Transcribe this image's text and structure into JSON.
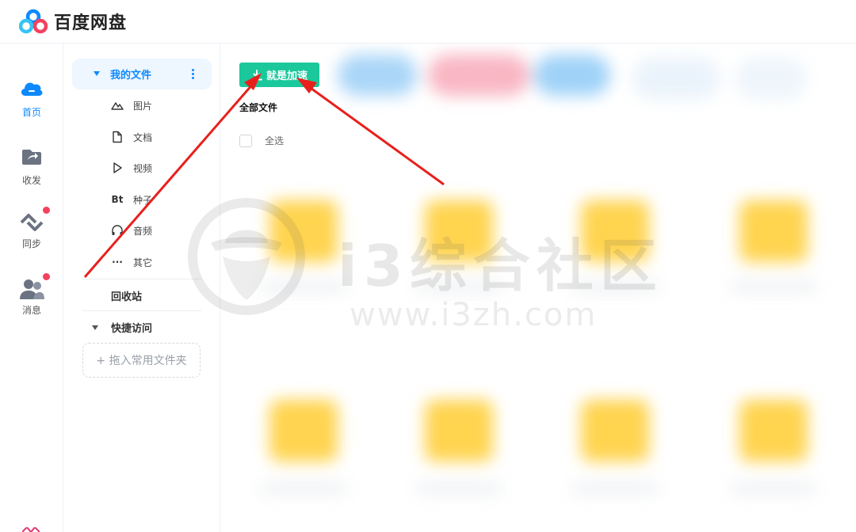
{
  "app": {
    "title": "百度网盘",
    "brand_colors": {
      "blue": "#0d89ff",
      "green": "#1ac89b",
      "red_dot": "#f3415e",
      "folder": "#ffd44f"
    }
  },
  "rail": {
    "items": [
      {
        "id": "home",
        "label": "首页",
        "icon": "cloud-icon",
        "active": true,
        "badge": false
      },
      {
        "id": "share",
        "label": "收发",
        "icon": "share-folder-icon",
        "active": false,
        "badge": false
      },
      {
        "id": "sync",
        "label": "同步",
        "icon": "sync-icon",
        "active": false,
        "badge": true
      },
      {
        "id": "messages",
        "label": "消息",
        "icon": "contacts-icon",
        "active": false,
        "badge": true
      }
    ]
  },
  "tree": {
    "root_label": "我的文件",
    "categories": [
      {
        "label": "图片",
        "icon": "image-icon"
      },
      {
        "label": "文档",
        "icon": "document-icon"
      },
      {
        "label": "视频",
        "icon": "video-icon",
        "glyph": "▷"
      },
      {
        "label": "种子",
        "icon": "torrent-icon",
        "glyph": "Bt"
      },
      {
        "label": "音频",
        "icon": "headphones-icon"
      },
      {
        "label": "其它",
        "icon": "more-icon",
        "glyph": "···"
      }
    ],
    "recycle_label": "回收站",
    "quick_access_label": "快捷访问",
    "drop_zone_label": "+ 拖入常用文件夹"
  },
  "main": {
    "accelerate_button": "就是加速",
    "breadcrumb": "全部文件",
    "select_all": "全选"
  },
  "watermark": {
    "text": "i3综合社区",
    "url": "www.i3zh.com"
  }
}
